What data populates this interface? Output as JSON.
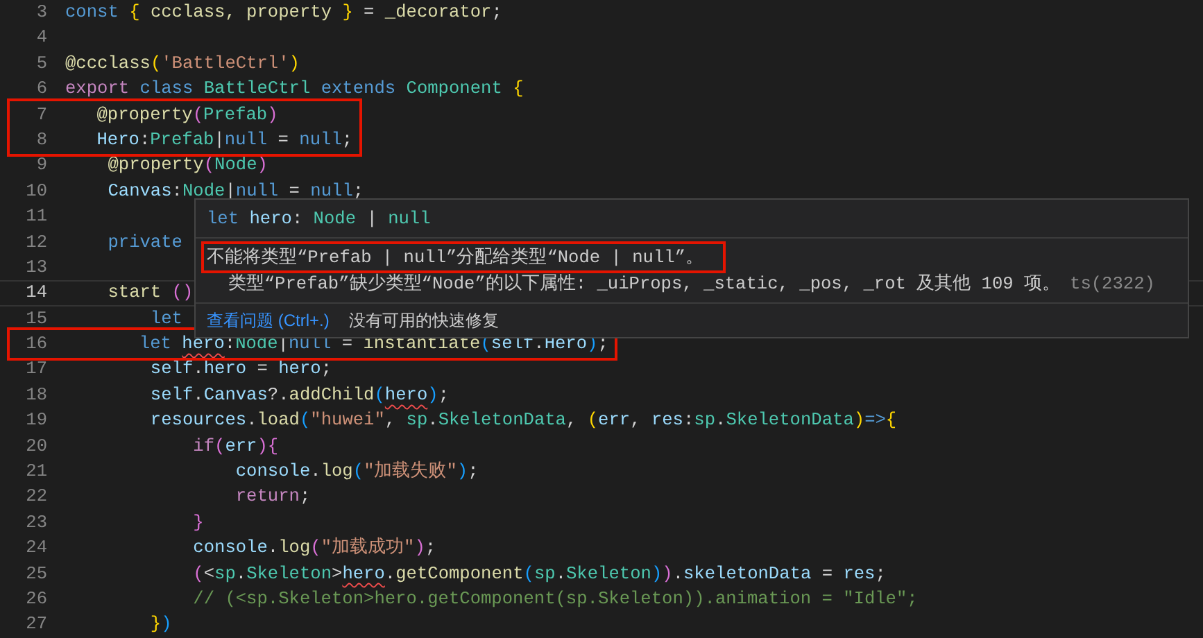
{
  "editor": {
    "lines": [
      {
        "n": "3",
        "tokens": [
          {
            "text": "const ",
            "kind": "kw"
          },
          {
            "text": "{",
            "kind": "b1"
          },
          {
            "text": " ccclass, property ",
            "kind": "fn"
          },
          {
            "text": "}",
            "kind": "b1"
          },
          {
            "text": " = ",
            "kind": "plain"
          },
          {
            "text": "_decorator",
            "kind": "fn"
          },
          {
            "text": ";",
            "kind": "plain"
          }
        ]
      },
      {
        "n": "4"
      },
      {
        "n": "5",
        "tokens": [
          {
            "text": "@ccclass",
            "kind": "fn"
          },
          {
            "text": "(",
            "kind": "b1"
          },
          {
            "text": "'BattleCtrl'",
            "kind": "str"
          },
          {
            "text": ")",
            "kind": "b1"
          }
        ]
      },
      {
        "n": "6",
        "tokens": [
          {
            "text": "export ",
            "kind": "ctl"
          },
          {
            "text": "class ",
            "kind": "kw"
          },
          {
            "text": "BattleCtrl ",
            "kind": "type"
          },
          {
            "text": "extends ",
            "kind": "kw"
          },
          {
            "text": "Component ",
            "kind": "type"
          },
          {
            "text": "{",
            "kind": "b1"
          }
        ]
      },
      {
        "n": "7",
        "red_box": true,
        "tokens": [
          {
            "text": "    @property",
            "kind": "fn"
          },
          {
            "text": "(",
            "kind": "b2"
          },
          {
            "text": "Prefab",
            "kind": "type"
          },
          {
            "text": ")",
            "kind": "b2"
          }
        ]
      },
      {
        "n": "8",
        "red_box": true,
        "tokens": [
          {
            "text": "    Hero",
            "kind": "var"
          },
          {
            "text": ":",
            "kind": "plain"
          },
          {
            "text": "Prefab",
            "kind": "type"
          },
          {
            "text": "|",
            "kind": "plain"
          },
          {
            "text": "null",
            "kind": "kw"
          },
          {
            "text": " = ",
            "kind": "plain"
          },
          {
            "text": "null",
            "kind": "kw"
          },
          {
            "text": ";",
            "kind": "plain"
          }
        ]
      },
      {
        "n": "9",
        "tokens": [
          {
            "text": "    @property",
            "kind": "fn"
          },
          {
            "text": "(",
            "kind": "b2"
          },
          {
            "text": "Node",
            "kind": "type"
          },
          {
            "text": ")",
            "kind": "b2"
          }
        ]
      },
      {
        "n": "10",
        "tokens": [
          {
            "text": "    Canvas",
            "kind": "var"
          },
          {
            "text": ":",
            "kind": "plain"
          },
          {
            "text": "Node",
            "kind": "type"
          },
          {
            "text": "|",
            "kind": "plain"
          },
          {
            "text": "null",
            "kind": "kw"
          },
          {
            "text": " = ",
            "kind": "plain"
          },
          {
            "text": "null",
            "kind": "kw"
          },
          {
            "text": ";",
            "kind": "plain"
          }
        ]
      },
      {
        "n": "11"
      },
      {
        "n": "12",
        "tokens": [
          {
            "text": "    private",
            "kind": "kw"
          }
        ]
      },
      {
        "n": "13"
      },
      {
        "n": "14",
        "current": true,
        "tokens": [
          {
            "text": "    start ",
            "kind": "fn"
          },
          {
            "text": "()",
            "kind": "b2"
          }
        ]
      },
      {
        "n": "15",
        "tokens": [
          {
            "text": "        let",
            "kind": "kw"
          }
        ]
      },
      {
        "n": "16",
        "red_box": true,
        "tokens": [
          {
            "text": "        let ",
            "kind": "kw"
          },
          {
            "text": "hero",
            "kind": "var",
            "squiggle": true
          },
          {
            "text": ":",
            "kind": "plain"
          },
          {
            "text": "Node",
            "kind": "type"
          },
          {
            "text": "|",
            "kind": "plain"
          },
          {
            "text": "null",
            "kind": "kw"
          },
          {
            "text": " = ",
            "kind": "plain"
          },
          {
            "text": "instantiate",
            "kind": "fn"
          },
          {
            "text": "(",
            "kind": "b3"
          },
          {
            "text": "self",
            "kind": "var"
          },
          {
            "text": ".",
            "kind": "plain"
          },
          {
            "text": "Hero",
            "kind": "var"
          },
          {
            "text": ")",
            "kind": "b3"
          },
          {
            "text": ";",
            "kind": "plain"
          }
        ]
      },
      {
        "n": "17",
        "tokens": [
          {
            "text": "        self",
            "kind": "var"
          },
          {
            "text": ".",
            "kind": "plain"
          },
          {
            "text": "hero",
            "kind": "var"
          },
          {
            "text": " = ",
            "kind": "plain"
          },
          {
            "text": "hero",
            "kind": "var"
          },
          {
            "text": ";",
            "kind": "plain"
          }
        ]
      },
      {
        "n": "18",
        "tokens": [
          {
            "text": "        self",
            "kind": "var"
          },
          {
            "text": ".",
            "kind": "plain"
          },
          {
            "text": "Canvas",
            "kind": "var"
          },
          {
            "text": "?.",
            "kind": "plain"
          },
          {
            "text": "addChild",
            "kind": "fn"
          },
          {
            "text": "(",
            "kind": "b3"
          },
          {
            "text": "hero",
            "kind": "var",
            "squiggle": true
          },
          {
            "text": ")",
            "kind": "b3"
          },
          {
            "text": ";",
            "kind": "plain"
          }
        ]
      },
      {
        "n": "19",
        "tokens": [
          {
            "text": "        resources",
            "kind": "var"
          },
          {
            "text": ".",
            "kind": "plain"
          },
          {
            "text": "load",
            "kind": "fn"
          },
          {
            "text": "(",
            "kind": "b3"
          },
          {
            "text": "\"huwei\"",
            "kind": "str"
          },
          {
            "text": ", ",
            "kind": "plain"
          },
          {
            "text": "sp",
            "kind": "type"
          },
          {
            "text": ".",
            "kind": "plain"
          },
          {
            "text": "SkeletonData",
            "kind": "type"
          },
          {
            "text": ", ",
            "kind": "plain"
          },
          {
            "text": "(",
            "kind": "b1"
          },
          {
            "text": "err",
            "kind": "var"
          },
          {
            "text": ", ",
            "kind": "plain"
          },
          {
            "text": "res",
            "kind": "var"
          },
          {
            "text": ":",
            "kind": "plain"
          },
          {
            "text": "sp",
            "kind": "type"
          },
          {
            "text": ".",
            "kind": "plain"
          },
          {
            "text": "SkeletonData",
            "kind": "type"
          },
          {
            "text": ")",
            "kind": "b1"
          },
          {
            "text": "=>",
            "kind": "kw"
          },
          {
            "text": "{",
            "kind": "b1"
          }
        ]
      },
      {
        "n": "20",
        "tokens": [
          {
            "text": "            if",
            "kind": "ctl"
          },
          {
            "text": "(",
            "kind": "b2"
          },
          {
            "text": "err",
            "kind": "var"
          },
          {
            "text": "){",
            "kind": "b2"
          }
        ]
      },
      {
        "n": "21",
        "tokens": [
          {
            "text": "                console",
            "kind": "var"
          },
          {
            "text": ".",
            "kind": "plain"
          },
          {
            "text": "log",
            "kind": "fn"
          },
          {
            "text": "(",
            "kind": "b3"
          },
          {
            "text": "\"加载失败\"",
            "kind": "str"
          },
          {
            "text": ")",
            "kind": "b3"
          },
          {
            "text": ";",
            "kind": "plain"
          }
        ]
      },
      {
        "n": "22",
        "tokens": [
          {
            "text": "                return",
            "kind": "ctl"
          },
          {
            "text": ";",
            "kind": "plain"
          }
        ]
      },
      {
        "n": "23",
        "tokens": [
          {
            "text": "            }",
            "kind": "b2"
          }
        ]
      },
      {
        "n": "24",
        "tokens": [
          {
            "text": "            console",
            "kind": "var"
          },
          {
            "text": ".",
            "kind": "plain"
          },
          {
            "text": "log",
            "kind": "fn"
          },
          {
            "text": "(",
            "kind": "b2"
          },
          {
            "text": "\"加载成功\"",
            "kind": "str"
          },
          {
            "text": ")",
            "kind": "b2"
          },
          {
            "text": ";",
            "kind": "plain"
          }
        ]
      },
      {
        "n": "25",
        "tokens": [
          {
            "text": "            (",
            "kind": "b2"
          },
          {
            "text": "<",
            "kind": "plain"
          },
          {
            "text": "sp",
            "kind": "type"
          },
          {
            "text": ".",
            "kind": "plain"
          },
          {
            "text": "Skeleton",
            "kind": "type"
          },
          {
            "text": ">",
            "kind": "plain"
          },
          {
            "text": "hero",
            "kind": "var",
            "squiggle": true
          },
          {
            "text": ".",
            "kind": "plain"
          },
          {
            "text": "getComponent",
            "kind": "fn"
          },
          {
            "text": "(",
            "kind": "b3"
          },
          {
            "text": "sp",
            "kind": "type"
          },
          {
            "text": ".",
            "kind": "plain"
          },
          {
            "text": "Skeleton",
            "kind": "type"
          },
          {
            "text": ")",
            "kind": "b3"
          },
          {
            "text": ")",
            "kind": "b2"
          },
          {
            "text": ".",
            "kind": "plain"
          },
          {
            "text": "skeletonData",
            "kind": "var"
          },
          {
            "text": " = ",
            "kind": "plain"
          },
          {
            "text": "res",
            "kind": "var"
          },
          {
            "text": ";",
            "kind": "plain"
          }
        ]
      },
      {
        "n": "26",
        "tokens": [
          {
            "text": "            // (<sp.Skeleton>hero.getComponent(sp.Skeleton)).animation = \"Idle\";",
            "kind": "cmt"
          }
        ]
      },
      {
        "n": "27",
        "tokens": [
          {
            "text": "        }",
            "kind": "b1"
          },
          {
            "text": ")",
            "kind": "b3"
          }
        ]
      }
    ]
  },
  "hover": {
    "signature": [
      {
        "text": "let ",
        "kind": "kw"
      },
      {
        "text": "hero",
        "kind": "var"
      },
      {
        "text": ": ",
        "kind": "plain"
      },
      {
        "text": "Node",
        "kind": "type"
      },
      {
        "text": " | ",
        "kind": "plain"
      },
      {
        "text": "null",
        "kind": "type"
      }
    ],
    "messages": [
      {
        "text": "不能将类型“Prefab | null”分配给类型“Node | null”。",
        "red_box": true
      },
      {
        "text": "  类型“Prefab”缺少类型“Node”的以下属性: _uiProps, _static, _pos, _rot 及其他 109 项。",
        "code": "ts(2322)"
      }
    ],
    "actions": [
      {
        "kind": "link",
        "text": "查看问题 (Ctrl+.)"
      },
      {
        "kind": "note",
        "text": "没有可用的快速修复"
      }
    ]
  }
}
